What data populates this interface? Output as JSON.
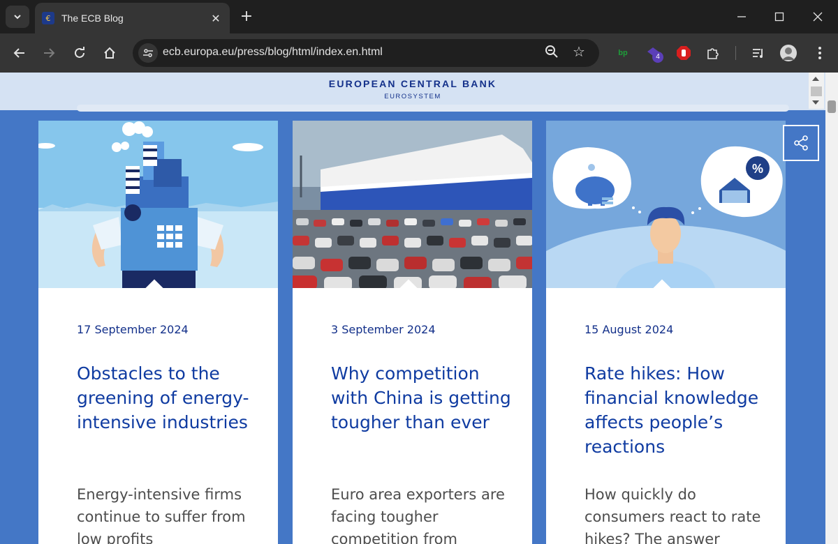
{
  "browser": {
    "tab_title": "The ECB Blog",
    "url": "ecb.europa.eu/press/blog/html/index.en.html",
    "extension_badge": "4",
    "extension_label": "bp"
  },
  "site": {
    "name": "EUROPEAN CENTRAL BANK",
    "sub": "EUROSYSTEM"
  },
  "cards": [
    {
      "date": "17 September 2024",
      "title": "Obstacles to the greening of energy-intensive industries",
      "excerpt": "Energy-intensive firms continue to suffer from low profits"
    },
    {
      "date": "3 September 2024",
      "title": "Why competition with China is getting tougher than ever",
      "excerpt": "Euro area exporters are facing tougher competition from"
    },
    {
      "date": "15 August 2024",
      "title": "Rate hikes: How financial knowledge affects people’s reactions",
      "excerpt": "How quickly do consumers react to rate hikes? The answer"
    }
  ],
  "illustration_text": {
    "percent": "%"
  },
  "colors": {
    "page_bg": "#4477c6",
    "header_bg": "#d5e2f3",
    "brand": "#13308a",
    "headline": "#0f3ba1",
    "excerpt": "#4d4d4d"
  }
}
